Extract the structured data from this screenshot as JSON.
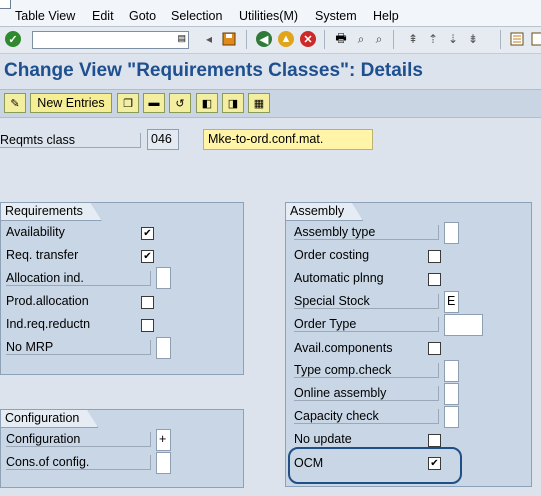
{
  "menu": [
    "Table View",
    "Edit",
    "Goto",
    "Selection",
    "Utilities(M)",
    "System",
    "Help"
  ],
  "title": "Change View \"Requirements Classes\": Details",
  "app_toolbar": {
    "new_entries": "New Entries"
  },
  "reqmts": {
    "label": "Reqmts class",
    "value": "046",
    "description": "Mke-to-ord.conf.mat."
  },
  "requirements_group": {
    "title": "Requirements",
    "availability": "Availability",
    "req_transfer": "Req. transfer",
    "allocation_ind": "Allocation ind.",
    "prod_allocation": "Prod.allocation",
    "ind_req_reductn": "Ind.req.reductn",
    "no_mrp": "No MRP"
  },
  "configuration_group": {
    "title": "Configuration",
    "configuration": "Configuration",
    "configuration_value": "+",
    "cons_of_config": "Cons.of config."
  },
  "assembly_group": {
    "title": "Assembly",
    "assembly_type": "Assembly type",
    "order_costing": "Order costing",
    "automatic_plnng": "Automatic plnng",
    "special_stock": "Special Stock",
    "special_stock_value": "E",
    "order_type": "Order Type",
    "avail_components": "Avail.components",
    "type_comp_check": "Type comp.check",
    "online_assembly": "Online assembly",
    "capacity_check": "Capacity check",
    "no_update": "No update",
    "ocm": "OCM"
  },
  "check_mark": "✔",
  "colors": {
    "title": "#1e4f8e",
    "group_bg": "#c8d6e5",
    "highlight": "#1f4f86",
    "new_entries_bg": "#f5ee95"
  }
}
